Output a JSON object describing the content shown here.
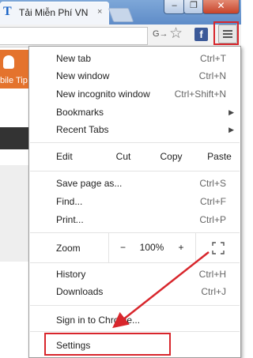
{
  "window": {
    "tab_title": "Tải Miễn Phí VN",
    "tab_close": "×",
    "favicon_letter": "T",
    "min_glyph": "–",
    "max_glyph": "❐",
    "close_glyph": "✕"
  },
  "toolbar": {
    "translate_glyph": "G→",
    "star_glyph": "☆",
    "fb_letter": "f"
  },
  "page": {
    "banner_text": "bile Tip"
  },
  "menu": {
    "items_top": [
      {
        "label": "New tab",
        "shortcut": "Ctrl+T"
      },
      {
        "label": "New window",
        "shortcut": "Ctrl+N"
      },
      {
        "label": "New incognito window",
        "shortcut": "Ctrl+Shift+N"
      },
      {
        "label": "Bookmarks",
        "shortcut": ""
      },
      {
        "label": "Recent Tabs",
        "shortcut": ""
      }
    ],
    "edit": {
      "label": "Edit",
      "cut": "Cut",
      "copy": "Copy",
      "paste": "Paste"
    },
    "items_mid": [
      {
        "label": "Save page as...",
        "shortcut": "Ctrl+S"
      },
      {
        "label": "Find...",
        "shortcut": "Ctrl+F"
      },
      {
        "label": "Print...",
        "shortcut": "Ctrl+P"
      }
    ],
    "zoom": {
      "label": "Zoom",
      "minus": "−",
      "level": "100%",
      "plus": "+"
    },
    "items_history": [
      {
        "label": "History",
        "shortcut": "Ctrl+H"
      },
      {
        "label": "Downloads",
        "shortcut": "Ctrl+J"
      }
    ],
    "sign_in": "Sign in to Chrome...",
    "settings": "Settings"
  },
  "colors": {
    "highlight": "#d8262c",
    "title_bar": "#6f9ad1",
    "banner": "#e4732d"
  }
}
